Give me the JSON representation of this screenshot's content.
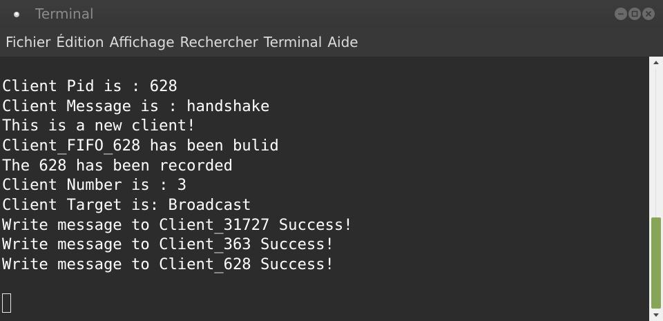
{
  "window": {
    "title": "Terminal",
    "icon": "terminal-app-icon",
    "controls": [
      "minimize-icon",
      "maximize-icon",
      "close-icon"
    ]
  },
  "menubar": {
    "items": [
      "Fichier",
      "Édition",
      "Affichage",
      "Rechercher",
      "Terminal",
      "Aide"
    ]
  },
  "terminal": {
    "lines": [
      "Client Pid is : 628",
      "Client Message is : handshake",
      "This is a new client!",
      "Client_FIFO_628 has been bulid",
      "The 628 has been recorded",
      "Client Number is : 3",
      "Client Target is: Broadcast",
      "Write message to Client_31727 Success!",
      "Write message to Client_363 Success!",
      "Write message to Client_628 Success!"
    ]
  },
  "colors": {
    "background": "#2c2c2c",
    "text": "#ffffff",
    "scroll_thumb": "#87a556"
  }
}
